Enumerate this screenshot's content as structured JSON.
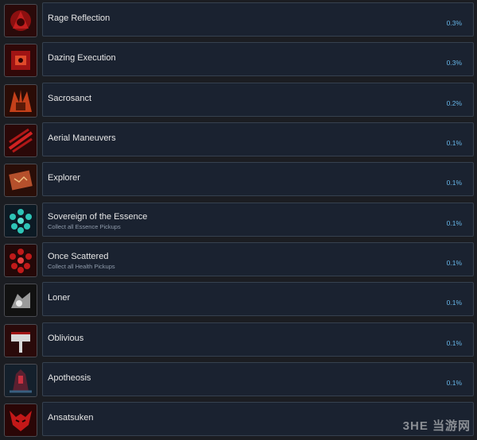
{
  "achievements": [
    {
      "name": "Rage Reflection",
      "description": "",
      "percent": "0.3%",
      "icon": "rage-reflection-icon"
    },
    {
      "name": "Dazing Execution",
      "description": "",
      "percent": "0.3%",
      "icon": "dazing-execution-icon"
    },
    {
      "name": "Sacrosanct",
      "description": "",
      "percent": "0.2%",
      "icon": "sacrosanct-icon"
    },
    {
      "name": "Aerial Maneuvers",
      "description": "",
      "percent": "0.1%",
      "icon": "aerial-maneuvers-icon"
    },
    {
      "name": "Explorer",
      "description": "",
      "percent": "0.1%",
      "icon": "explorer-map-icon"
    },
    {
      "name": "Sovereign of the Essence",
      "description": "Collect all Essence Pickups",
      "percent": "0.1%",
      "icon": "essence-orbs-icon"
    },
    {
      "name": "Once Scattered",
      "description": "Collect all Health Pickups",
      "percent": "0.1%",
      "icon": "health-orbs-icon"
    },
    {
      "name": "Loner",
      "description": "",
      "percent": "0.1%",
      "icon": "loner-icon"
    },
    {
      "name": "Oblivious",
      "description": "",
      "percent": "0.1%",
      "icon": "oblivious-sign-icon"
    },
    {
      "name": "Apotheosis",
      "description": "",
      "percent": "0.1%",
      "icon": "apotheosis-icon"
    },
    {
      "name": "Ansatsuken",
      "description": "",
      "percent": "",
      "icon": "ansatsuken-demon-icon"
    }
  ],
  "watermark": "3HE 当游网"
}
